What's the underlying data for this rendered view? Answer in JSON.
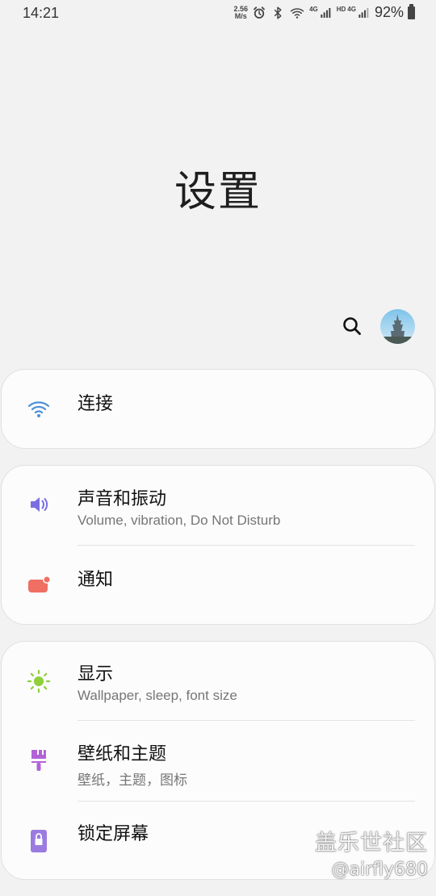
{
  "status_bar": {
    "time": "14:21",
    "net_speed_value": "2.56",
    "net_speed_unit": "M/s",
    "icons": [
      "alarm-icon",
      "bluetooth-icon",
      "wifi-icon",
      "signal-4g-icon",
      "hd-icon",
      "signal-4g-icon"
    ],
    "sig1_label": "4G",
    "hd_label": "HD",
    "sig2_label": "4G",
    "battery_percent": "92%"
  },
  "header": {
    "title": "设置",
    "search_icon": "search-icon",
    "avatar": "avatar"
  },
  "groups": [
    {
      "items": [
        {
          "title": "连接",
          "subtitle": "",
          "icon": "wifi-icon",
          "icon_color": "#4a90d9"
        }
      ]
    },
    {
      "items": [
        {
          "title": "声音和振动",
          "subtitle": "Volume, vibration, Do Not Disturb",
          "icon": "speaker-icon",
          "icon_color": "#7b6ee0"
        },
        {
          "title": "通知",
          "subtitle": "",
          "icon": "notification-icon",
          "icon_color": "#ef6f63"
        }
      ]
    },
    {
      "items": [
        {
          "title": "显示",
          "subtitle": "Wallpaper, sleep, font size",
          "icon": "brightness-icon",
          "icon_color": "#8fcf3a"
        },
        {
          "title": "壁纸和主题",
          "subtitle": "壁纸，主题，图标",
          "icon": "paintbrush-icon",
          "icon_color": "#b162d6"
        },
        {
          "title": "锁定屏幕",
          "subtitle": "",
          "icon": "lock-icon",
          "icon_color": "#9b7be0"
        }
      ]
    }
  ],
  "watermark": {
    "line1": "盖乐世社区",
    "line2": "@airfly680"
  }
}
